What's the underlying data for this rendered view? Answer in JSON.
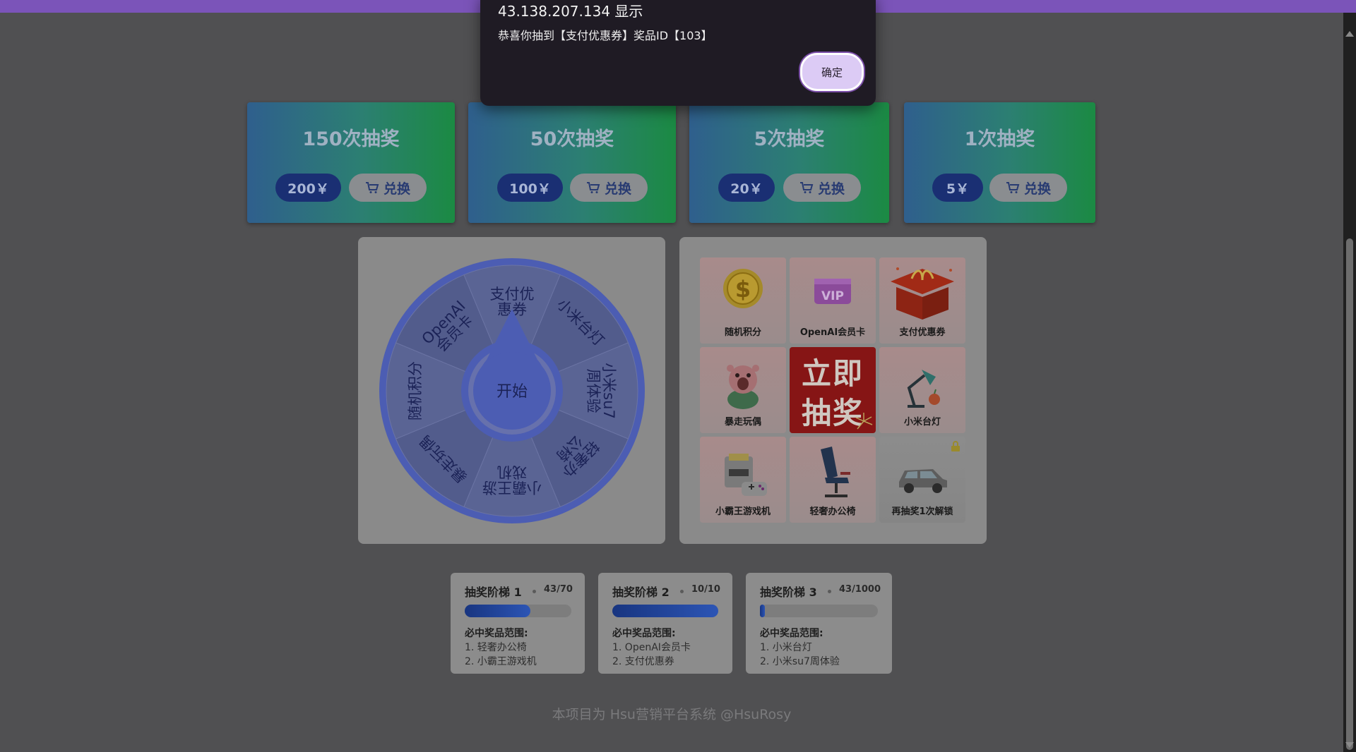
{
  "dialog": {
    "title": "43.138.207.134 显示",
    "message": "恭喜你抽到【支付优惠券】奖品ID【103】",
    "ok_label": "确定"
  },
  "packages": [
    {
      "title": "150次抽奖",
      "price": "200￥",
      "exchange": "兑换"
    },
    {
      "title": "50次抽奖",
      "price": "100￥",
      "exchange": "兑换"
    },
    {
      "title": "5次抽奖",
      "price": "20￥",
      "exchange": "兑换"
    },
    {
      "title": "1次抽奖",
      "price": "5￥",
      "exchange": "兑换"
    }
  ],
  "wheel": {
    "start_label": "开始",
    "segments": [
      "支付优惠券",
      "小米台灯",
      "小米su7周体验",
      "轻奢办公椅",
      "小霸王游戏机",
      "暴走玩偶",
      "随机积分",
      "OpenAI会员卡"
    ]
  },
  "grid": {
    "cells": [
      {
        "label": "随机积分",
        "icon": "coin-icon"
      },
      {
        "label": "OpenAI会员卡",
        "icon": "vip-card-icon"
      },
      {
        "label": "支付优惠券",
        "icon": "gift-box-icon"
      },
      {
        "label": "暴走玩偶",
        "icon": "doll-icon"
      },
      {
        "label": "立即抽奖",
        "icon": "draw-button"
      },
      {
        "label": "小米台灯",
        "icon": "desk-lamp-icon"
      },
      {
        "label": "小霸王游戏机",
        "icon": "game-console-icon"
      },
      {
        "label": "轻奢办公椅",
        "icon": "office-chair-icon"
      },
      {
        "label": "再抽奖1次解锁",
        "icon": "car-icon"
      }
    ],
    "draw_line1": "立即",
    "draw_line2": "抽奖"
  },
  "ladders": [
    {
      "title": "抽奖阶梯 1",
      "count": "43/70",
      "progress": 0.614,
      "range_label": "必中奖品范围:",
      "items": [
        "1. 轻奢办公椅",
        "2. 小霸王游戏机"
      ]
    },
    {
      "title": "抽奖阶梯 2",
      "count": "10/10",
      "progress": 1.0,
      "range_label": "必中奖品范围:",
      "items": [
        "1. OpenAI会员卡",
        "2. 支付优惠券"
      ]
    },
    {
      "title": "抽奖阶梯 3",
      "count": "43/1000",
      "progress": 0.043,
      "range_label": "必中奖品范围:",
      "items": [
        "1. 小米台灯",
        "2. 小米su7周体验"
      ]
    }
  ],
  "footer": "本项目为 Hsu营销平台系统 @HsuRosy",
  "colors": {
    "accent_purple": "#7b54b9",
    "wheel_blue": "#4c5db3",
    "draw_red": "#861515",
    "progress_blue": "#2c55b5"
  }
}
